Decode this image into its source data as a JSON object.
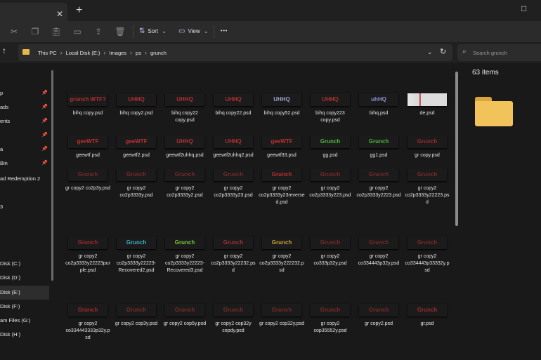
{
  "titlebar": {
    "tab_close": "✕",
    "new_tab": "+",
    "maximize": "□"
  },
  "toolbar": {
    "sort_label": "Sort",
    "view_label": "View",
    "more": "•••",
    "chev": "⌄"
  },
  "address": {
    "crumbs": [
      "This PC",
      "Local Disk (E:)",
      "Images",
      "ps",
      "grunch"
    ],
    "separator": "›",
    "dropdown": "⌄",
    "refresh": "↻",
    "up": "↑"
  },
  "search": {
    "placeholder": "Search grunch"
  },
  "sidebar": {
    "items": [
      {
        "label": "p",
        "pinned": true
      },
      {
        "label": "ads",
        "pinned": true
      },
      {
        "label": "ents",
        "pinned": true
      },
      {
        "label": "",
        "pinned": true
      },
      {
        "label": "a",
        "pinned": true
      },
      {
        "label": "Bin",
        "pinned": true
      },
      {
        "label": "ad Redemption 2",
        "pinned": false
      },
      {
        "label": "",
        "pinned": false
      },
      {
        "label": "3",
        "pinned": false
      },
      {
        "label": "",
        "pinned": false
      },
      {
        "label": "Disk (C:)",
        "pinned": false
      },
      {
        "label": "Disk (D:)",
        "pinned": false
      },
      {
        "label": "Disk (E:)",
        "pinned": false,
        "selected": true
      },
      {
        "label": "Disk (F:)",
        "pinned": false
      },
      {
        "label": "am Files (G:)",
        "pinned": false
      },
      {
        "label": "Disk (H:)",
        "pinned": false
      }
    ],
    "pin_glyph": "📌"
  },
  "details": {
    "count": "63 items"
  },
  "colors": {
    "accent": "#c05010",
    "folder": "#f2c35b",
    "selection": "#2d2d2d"
  },
  "files": [
    {
      "name": "bihq copy.psd",
      "thumb": "grunch WTF?",
      "color": "#b03030"
    },
    {
      "name": "bihq copy2.psd",
      "thumb": "UHHQ",
      "color": "#b03030"
    },
    {
      "name": "bihq copy22 copy.psd",
      "thumb": "UHHQ",
      "color": "#b03030"
    },
    {
      "name": "bihq copy22.psd",
      "thumb": "UHHQ",
      "color": "#b03030"
    },
    {
      "name": "bihq copy52.psd",
      "thumb": "UHHQ",
      "color": "#9aa0c8"
    },
    {
      "name": "bihq copy223 copy.psd",
      "thumb": "UHHQ",
      "color": "#b03030"
    },
    {
      "name": "bihq.psd",
      "thumb": "uhHQ",
      "color": "#8a90d0"
    },
    {
      "name": "de.psd",
      "thumb": "",
      "color": "#c0c0c0"
    },
    {
      "name": "geewtf.psd",
      "thumb": "geeWTF",
      "color": "#c03030"
    },
    {
      "name": "geewtf2.psd",
      "thumb": "geeWTF",
      "color": "#c03030"
    },
    {
      "name": "geewtf2uhhq.psd",
      "thumb": "UHHQ",
      "color": "#b03030"
    },
    {
      "name": "geewtf2uhhq2.psd",
      "thumb": "UHHQ",
      "color": "#b03030"
    },
    {
      "name": "geewtf33.psd",
      "thumb": "geeWTF",
      "color": "#c03030"
    },
    {
      "name": "gg.psd",
      "thumb": "Grunch",
      "color": "#4ab83a"
    },
    {
      "name": "gg1.psd",
      "thumb": "Grunch",
      "color": "#4ab83a"
    },
    {
      "name": "gr copy.psd",
      "thumb": "Grunch",
      "color": "#9a2a2a"
    },
    {
      "name": "gr copy2 co2p3y.psd",
      "thumb": "Grunch",
      "color": "#7a2a2a"
    },
    {
      "name": "gr copy2 co2p3333y.psd",
      "thumb": "Grunch",
      "color": "#7a2a2a"
    },
    {
      "name": "gr copy2 co2p3333y2.psd",
      "thumb": "Grunch",
      "color": "#7a2a2a"
    },
    {
      "name": "gr copy2 co2p3333y23.psd",
      "thumb": "Grunch",
      "color": "#7a2a2a"
    },
    {
      "name": "gr copy2 co2p3333y23reversed.psd",
      "thumb": "Grunch",
      "color": "#c03030"
    },
    {
      "name": "gr copy2 co2p3333y223.psd",
      "thumb": "Grunch",
      "color": "#7a2a2a"
    },
    {
      "name": "gr copy2 co2p3333y2223.psd",
      "thumb": "Grunch",
      "color": "#7a2a2a"
    },
    {
      "name": "gr copy2 co2p3333y22223.psd",
      "thumb": "Grunch",
      "color": "#7a2a2a"
    },
    {
      "name": "gr copy2 co2p3333y22223purple.psd",
      "thumb": "Grunch",
      "color": "#a02a2a"
    },
    {
      "name": "gr copy2 co2p3333y22223-Recovered2.psd",
      "thumb": "Grunch",
      "color": "#3ab0c8"
    },
    {
      "name": "gr copy2 co2p3333y22223-Recovered3.psd",
      "thumb": "Grunch",
      "color": "#7ac83a"
    },
    {
      "name": "gr copy2 co2p3333y22232.psd",
      "thumb": "Grunch",
      "color": "#a03030"
    },
    {
      "name": "gr copy2 co2p3333y222232.psd",
      "thumb": "Grunch",
      "color": "#c8a03a"
    },
    {
      "name": "gr copy2 co333p32y.psd",
      "thumb": "Grunch",
      "color": "#7a2a2a"
    },
    {
      "name": "gr copy2 co334443p32y.psd",
      "thumb": "Grunch",
      "color": "#7a2a2a"
    },
    {
      "name": "gr copy2 co334443p33332y.psd",
      "thumb": "Grunch",
      "color": "#7a2a2a"
    },
    {
      "name": "gr copy2 co334443333p32y.psd",
      "thumb": "Grunch",
      "color": "#a02a2a"
    },
    {
      "name": "gr copy2 cop3y.psd",
      "thumb": "Grunch",
      "color": "#7a2a2a"
    },
    {
      "name": "gr copy2 cop5y.psd",
      "thumb": "Grunch",
      "color": "#7a2a2a"
    },
    {
      "name": "gr copy2 cop32y copdy.psd",
      "thumb": "Grunch",
      "color": "#7a2a2a"
    },
    {
      "name": "gr copy2 cop32y.psd",
      "thumb": "Grunch",
      "color": "#7a2a2a"
    },
    {
      "name": "gr copy2 cop35552y.psd",
      "thumb": "Grunch",
      "color": "#7a2a2a"
    },
    {
      "name": "gr copy2.psd",
      "thumb": "Grunch",
      "color": "#7a2a2a"
    },
    {
      "name": "gr.psd",
      "thumb": "Grunch",
      "color": "#9a2a2a"
    }
  ]
}
